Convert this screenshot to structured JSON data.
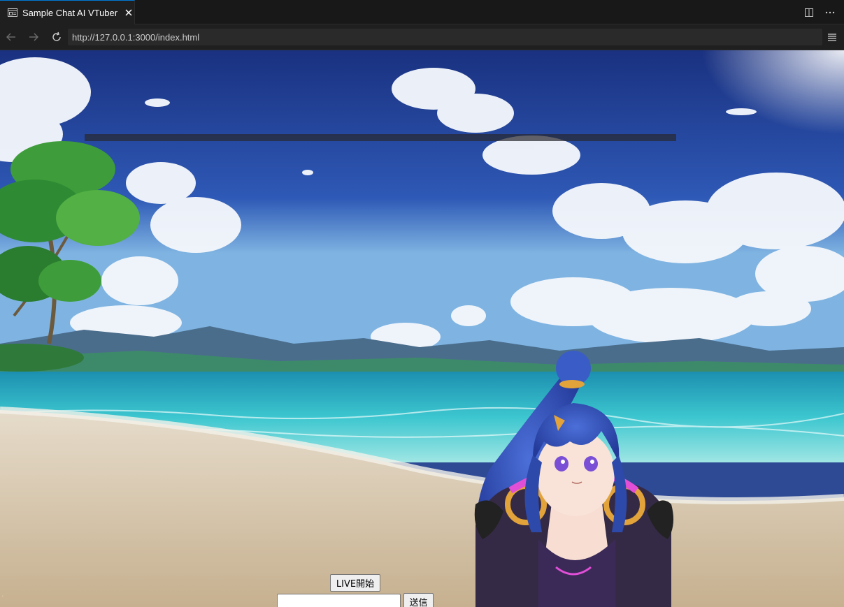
{
  "tab": {
    "title": "Sample Chat AI VTuber",
    "icon": "preview-icon",
    "close_icon": "close-icon"
  },
  "tab_actions": [
    "split-editor-icon",
    "more-actions-icon"
  ],
  "nav": {
    "url": "http://127.0.0.1:3000/index.html",
    "back_icon": "arrow-left-icon",
    "forward_icon": "arrow-right-icon",
    "reload_icon": "reload-icon",
    "menu_icon": "hamburger-icon"
  },
  "page": {
    "subtitle": "",
    "live_button_label": "LIVE開始",
    "message_input_value": "",
    "send_button_label": "送信",
    "background": "anime beach with blue sky and clouds",
    "avatar": "anime VTuber girl with blue ponytail"
  },
  "colors": {
    "accent": "#0078d4",
    "chrome_bg": "#181818",
    "sky_top": "#1e3a8a",
    "sea": "#2fb3c8",
    "sand": "#d8c9b0"
  }
}
